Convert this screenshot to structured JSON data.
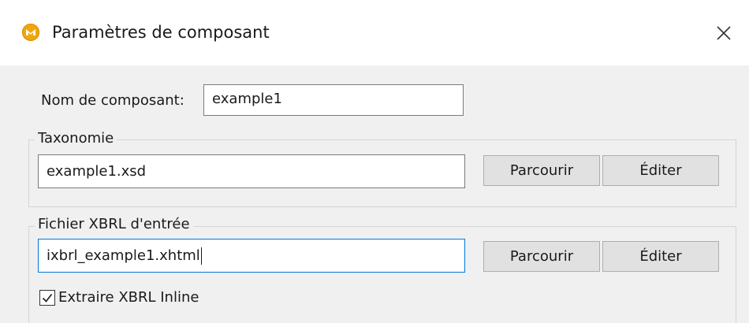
{
  "window": {
    "title": "Paramètres de composant",
    "icon": "app-logo-icon",
    "close_icon": "close-icon"
  },
  "component_name": {
    "label": "Nom de composant:",
    "value": "example1"
  },
  "taxonomy": {
    "legend": "Taxonomie",
    "value": "example1.xsd",
    "browse_label": "Parcourir",
    "edit_label": "Éditer"
  },
  "input_file": {
    "legend": "Fichier XBRL d'entrée",
    "value": "ixbrl_example1.xhtml",
    "browse_label": "Parcourir",
    "edit_label": "Éditer",
    "extract_inline": {
      "label": "Extraire XBRL Inline",
      "checked": true
    }
  },
  "colors": {
    "accent": "#0078d7",
    "app_icon": "#f0a70d"
  }
}
